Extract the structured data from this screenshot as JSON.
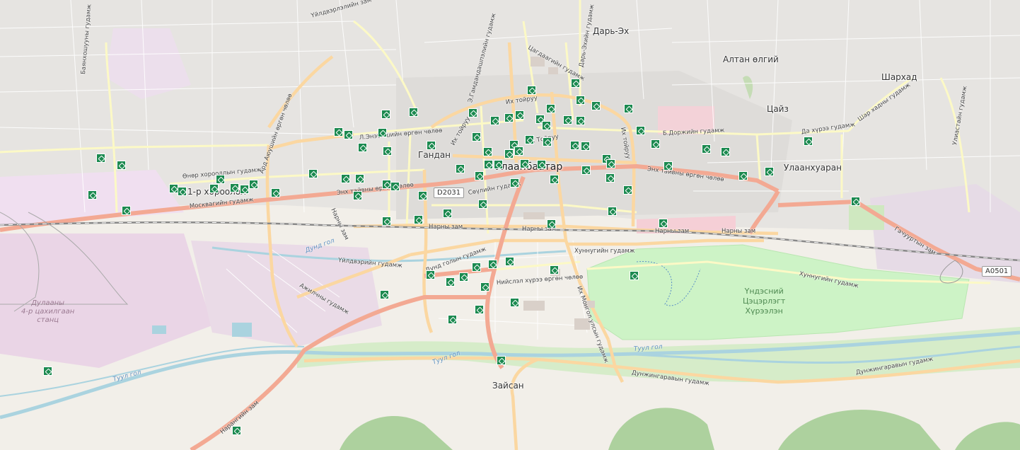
{
  "map": {
    "places": [
      {
        "id": "darkhan-ekh",
        "text": "Дарь-Эх"
      },
      {
        "id": "altan-olgii",
        "text": "Алтан өлгий"
      },
      {
        "id": "sharkhad",
        "text": "Шархад"
      },
      {
        "id": "tsaiz",
        "text": "Цайз"
      },
      {
        "id": "gandan",
        "text": "Гандан"
      },
      {
        "id": "1r-khoroolol",
        "text": "1-р хороолол"
      },
      {
        "id": "ulaankhuaran",
        "text": "Улаанхуаран"
      },
      {
        "id": "zaisan",
        "text": "Зайсан"
      }
    ],
    "city": "Улаанбаатар",
    "park_label": [
      "Үндэсний",
      "Цэцэрлэгт",
      "Хүрээлэн"
    ],
    "landuse_label": [
      "Дулааны",
      "4-р цахилгаан",
      "станц"
    ],
    "road_shields": [
      "D2031",
      "A0501"
    ],
    "streets": [
      {
        "id": "ikh-toiruu-n",
        "text": "Их тойруу"
      },
      {
        "id": "ikh-toiruu-w",
        "text": "Их тойруу"
      },
      {
        "id": "ikh-toiruu-e",
        "text": "Их тойруу"
      },
      {
        "id": "ikh-toiruu-c",
        "text": "Их Тойруу"
      },
      {
        "id": "enkh-tayvan-w",
        "text": "Энх тайвны өргөн чөлөө"
      },
      {
        "id": "enkh-tayvan-e",
        "text": "Энх тайвны өргөн чөлөө"
      },
      {
        "id": "moskva",
        "text": "Москвагийн гудамж"
      },
      {
        "id": "narny-zam-1",
        "text": "Нарны зам"
      },
      {
        "id": "narny-zam-2",
        "text": "Нарны зам"
      },
      {
        "id": "narny-zam-3",
        "text": "Нарны зам"
      },
      {
        "id": "narny-zam-4",
        "text": "Нарны зам"
      },
      {
        "id": "narny-zam-5",
        "text": "Нарны зам"
      },
      {
        "id": "khunnu-1",
        "text": "Хуннугийн гудамж"
      },
      {
        "id": "khunnu-2",
        "text": "Хуннугийн гудамж"
      },
      {
        "id": "niislel",
        "text": "Нийслэл хүрээ өргөн чөлөө"
      },
      {
        "id": "duund-gol",
        "text": "Дунд голын гудамж"
      },
      {
        "id": "uildver",
        "text": "Үйлдвэрийн гудамж"
      },
      {
        "id": "ajilchin",
        "text": "Ажилчны гудамж"
      },
      {
        "id": "dunjingarav-1",
        "text": "Дунжингаравын гудамж"
      },
      {
        "id": "dunjingarav-2",
        "text": "Дунжингаравын гудамж"
      },
      {
        "id": "narangiin",
        "text": "Нарангийн зам"
      },
      {
        "id": "gachuurt",
        "text": "Гачууртын зам"
      },
      {
        "id": "seoul",
        "text": "Сөүлийн гудамж"
      },
      {
        "id": "doijin",
        "text": "Б.Доржийн гудамж"
      },
      {
        "id": "da-khuree",
        "text": "Да хүрээ гудамж"
      },
      {
        "id": "shar-khad",
        "text": "Шар хадны гудамж"
      },
      {
        "id": "ulyasutai",
        "text": "Улиастайн гудамж"
      },
      {
        "id": "onor",
        "text": "Өнөр хорооллын гудамж"
      },
      {
        "id": "ard-ayush",
        "text": "Ард Аюушийн өргөн чөлөө"
      },
      {
        "id": "l-enkhee",
        "text": "Л.Энэбишийн өргөн чөлөө"
      },
      {
        "id": "sukhbaatar-n",
        "text": "Э.Гамдандашпэлийн гудамж"
      },
      {
        "id": "tsagdaa",
        "text": "Цагдаагийн гудамж"
      },
      {
        "id": "mongol-uls",
        "text": "Их Монгол улсын гудамж"
      },
      {
        "id": "baruun-uul",
        "text": "Баянхошууны гудамж"
      },
      {
        "id": "dari-ekh-st",
        "text": "Дарь-Эхийн гудамж"
      },
      {
        "id": "uvsgalan",
        "text": "Үйлдвэрлэлийн зам"
      }
    ],
    "waters": [
      {
        "id": "tuul-1",
        "text": "Туул гол"
      },
      {
        "id": "tuul-2",
        "text": "Туул гол"
      },
      {
        "id": "tuul-3",
        "text": "Туул гол"
      },
      {
        "id": "duund-gol-w",
        "text": "Дунд гол"
      }
    ],
    "poi_icon": "bus-station-icon",
    "poi_color": "#1c8a50",
    "colors": {
      "primary_road": "#f3a993",
      "secondary_road": "#fbd7a1",
      "tertiary_road": "#fcf9c6",
      "park": "#cdf3c6",
      "residential": "#e0dfdf",
      "industrial": "#ebdbe8",
      "water": "#aad3df",
      "forest": "#add19e",
      "rail": "#999999"
    }
  }
}
